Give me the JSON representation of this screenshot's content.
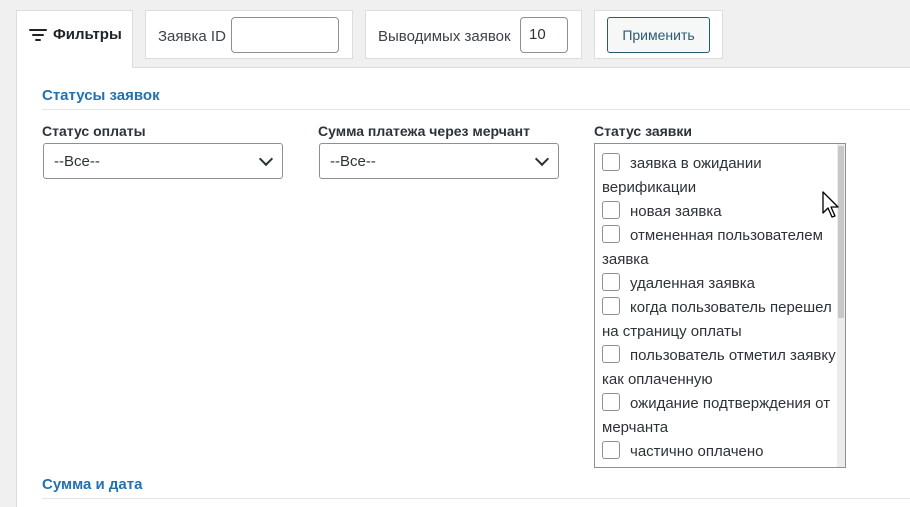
{
  "tabs": {
    "filters_label": "Фильтры",
    "request_id_label": "Заявка ID",
    "request_id_value": "",
    "count_label": "Выводимых заявок",
    "count_value": "10",
    "apply_label": "Применить"
  },
  "sections": {
    "statuses_title": "Статусы заявок",
    "amount_date_title": "Сумма и дата"
  },
  "fields": {
    "payment_status_label": "Статус оплаты",
    "payment_status_value": "--Все--",
    "merchant_sum_label": "Сумма платежа через мерчант",
    "merchant_sum_value": "--Все--",
    "request_status_label": "Статус заявки"
  },
  "request_status_options": [
    "заявка в ожидании верификации",
    "новая заявка",
    "отмененная пользователем заявка",
    "удаленная заявка",
    "когда пользователь перешел на страницу оплаты",
    "пользователь отметил заявку как оплаченную",
    "ожидание подтверждения от мерчанта",
    "частично оплачено"
  ],
  "colors": {
    "accent": "#2271b1",
    "apply_border": "#2c5a73"
  },
  "icons": [
    "filter-icon",
    "chevron-down-icon",
    "mouse-cursor-icon"
  ]
}
